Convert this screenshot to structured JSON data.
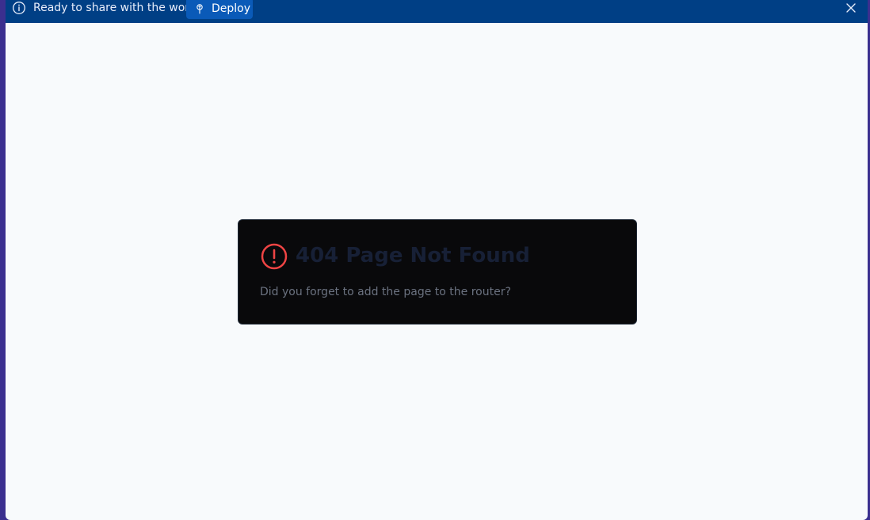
{
  "banner": {
    "message": "Ready to share with the world?",
    "deploy_label": "Deploy",
    "icons": {
      "info": "info-icon",
      "deploy": "deploy-icon",
      "close": "close-icon"
    },
    "colors": {
      "background": "#003f85",
      "button": "#0a5ab8"
    }
  },
  "error_card": {
    "title": "404 Page Not Found",
    "message": "Did you forget to add the page to the router?",
    "icon": "alert-circle-icon",
    "colors": {
      "icon": "#ef4444",
      "background": "#09090b"
    }
  }
}
